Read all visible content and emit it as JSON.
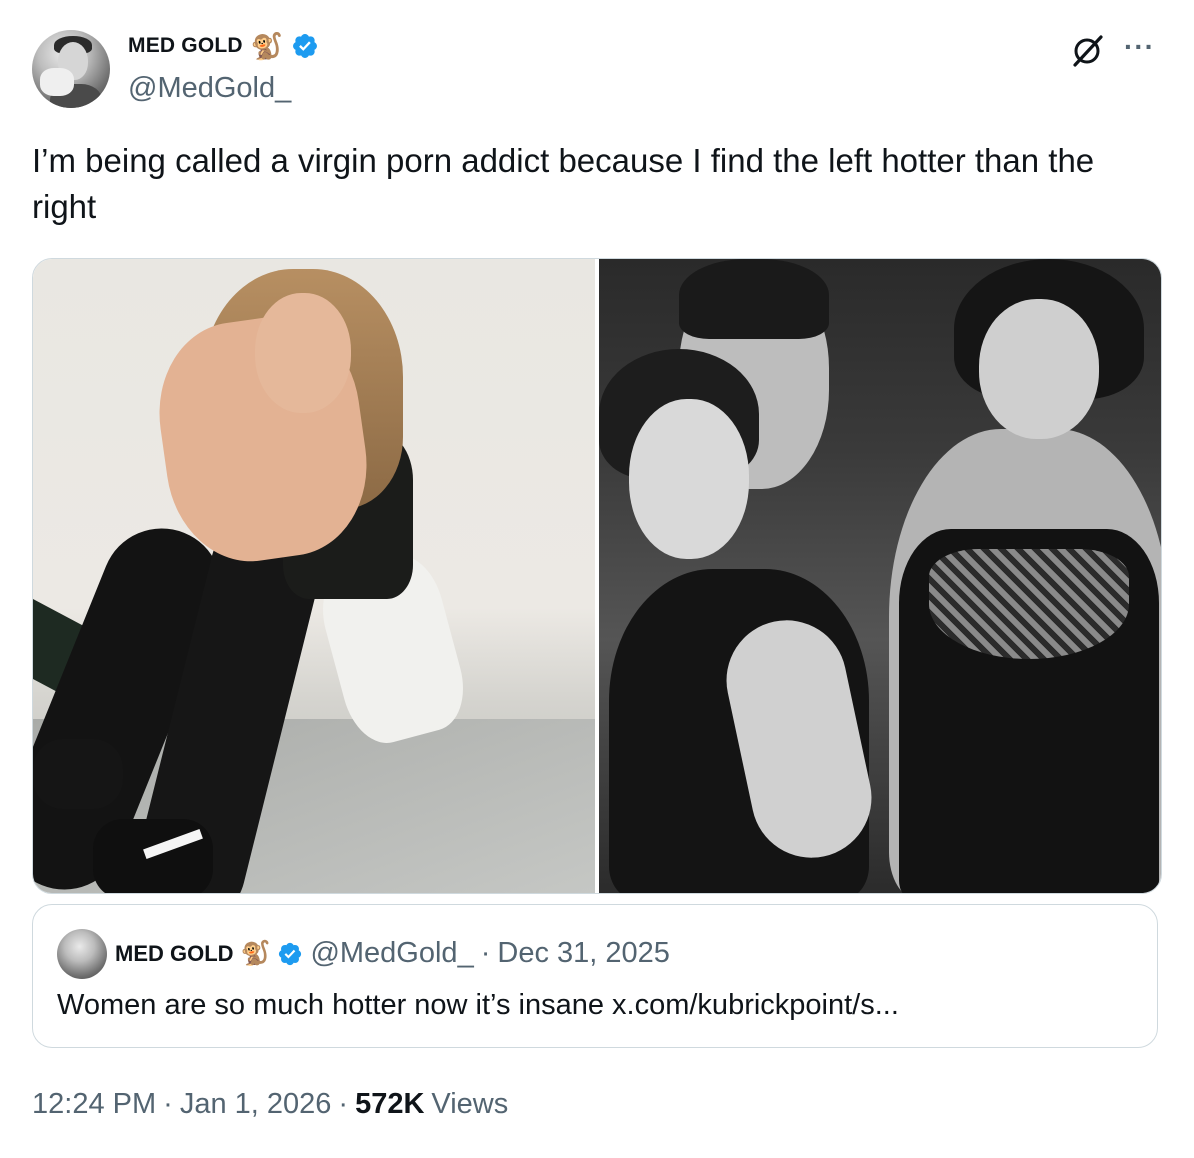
{
  "author": {
    "display_name": "MED GOLD",
    "emoji": "🐒",
    "handle": "@MedGold_",
    "verified": true
  },
  "tweet": {
    "text": "I’m being called a virgin porn addict because I find the left hotter than the right"
  },
  "media": {
    "count": 2
  },
  "quoted_tweet": {
    "display_name": "MED GOLD",
    "emoji": "🐒",
    "handle": "@MedGold_",
    "separator": "·",
    "date": "Dec 31, 2025",
    "text": "Women are so much hotter now it’s insane x.com/kubrickpoint/s..."
  },
  "meta": {
    "time": "12:24 PM",
    "separator": "·",
    "date": "Jan 1, 2026",
    "views_count": "572K",
    "views_label": "Views"
  },
  "icons": {
    "more": "more-icon",
    "grok": "grok-icon",
    "verified": "verified-badge-icon"
  },
  "colors": {
    "text": "#0f1419",
    "secondary": "#536471",
    "verified": "#1d9bf0",
    "border": "#cfd9de"
  }
}
